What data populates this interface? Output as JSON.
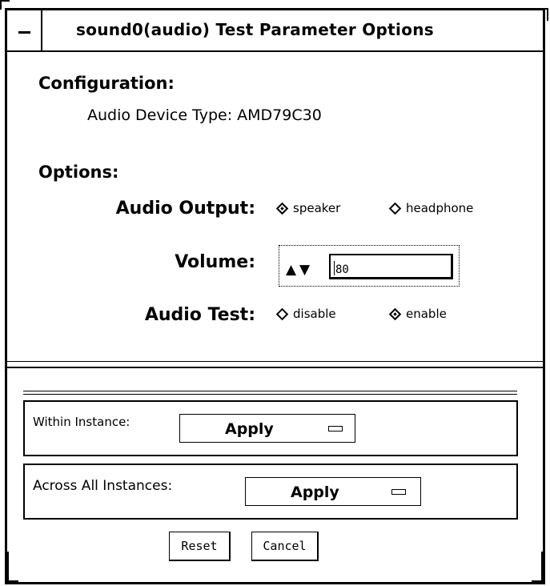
{
  "window": {
    "title": "sound0(audio) Test Parameter Options"
  },
  "configuration": {
    "heading": "Configuration:",
    "device_type": "Audio Device Type: AMD79C30"
  },
  "options": {
    "heading": "Options:",
    "audio_output": {
      "label": "Audio Output:",
      "choices": [
        {
          "label": "speaker",
          "selected": true
        },
        {
          "label": "headphone",
          "selected": false
        }
      ]
    },
    "volume": {
      "label": "Volume:",
      "value": "80"
    },
    "audio_test": {
      "label": "Audio Test:",
      "choices": [
        {
          "label": "disable",
          "selected": false
        },
        {
          "label": "enable",
          "selected": true
        }
      ]
    }
  },
  "within_instance": {
    "label": "Within Instance:",
    "button": "Apply"
  },
  "across_instances": {
    "label": "Across All Instances:",
    "button": "Apply"
  },
  "buttons": {
    "reset": "Reset",
    "cancel": "Cancel"
  }
}
